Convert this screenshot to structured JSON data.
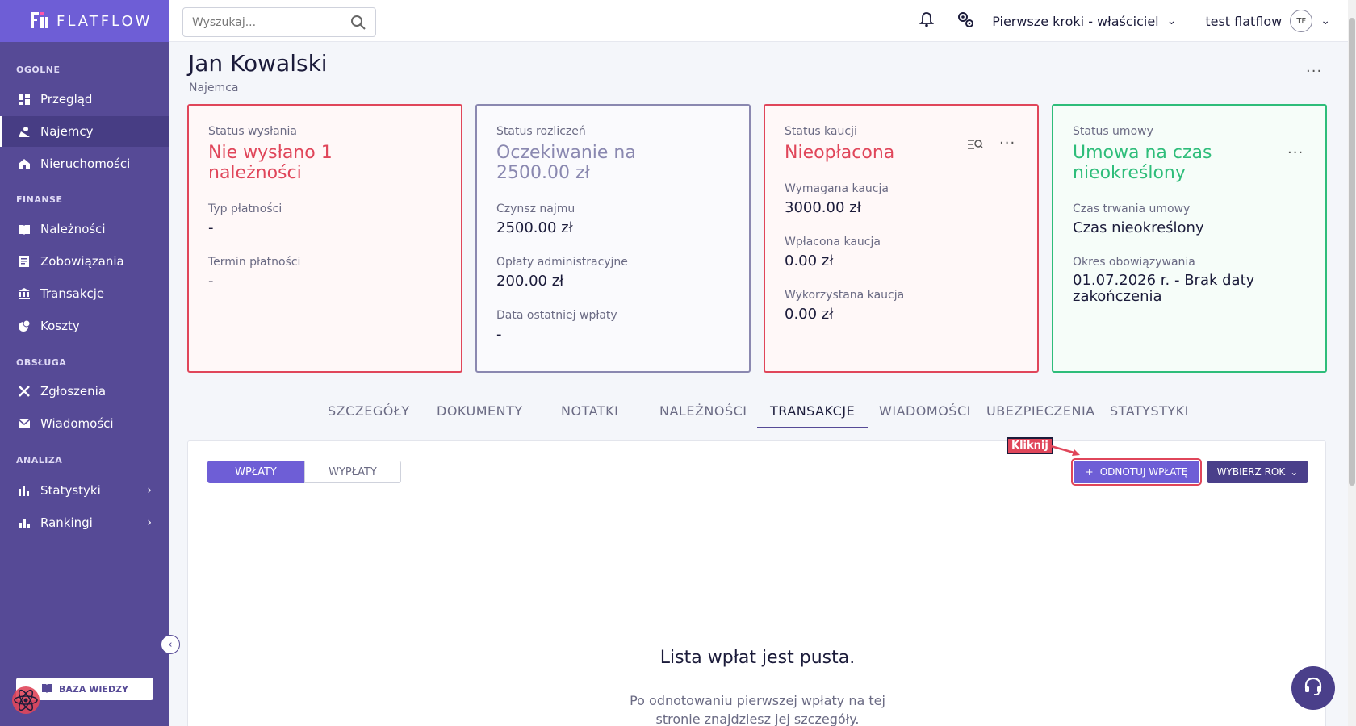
{
  "app": {
    "logo_text": "FLATFLOW"
  },
  "sidebar": {
    "sections": [
      {
        "label": "OGÓLNE"
      },
      {
        "label": "FINANSE"
      },
      {
        "label": "OBSŁUGA"
      },
      {
        "label": "ANALIZA"
      }
    ],
    "items": [
      {
        "label": "Przegląd",
        "icon": "dashboard-icon"
      },
      {
        "label": "Najemcy",
        "icon": "tenants-icon",
        "active": true
      },
      {
        "label": "Nieruchomości",
        "icon": "properties-icon"
      },
      {
        "label": "Należności",
        "icon": "receivables-icon"
      },
      {
        "label": "Zobowiązania",
        "icon": "liabilities-icon"
      },
      {
        "label": "Transakcje",
        "icon": "bank-icon"
      },
      {
        "label": "Koszty",
        "icon": "costs-icon"
      },
      {
        "label": "Zgłoszenia",
        "icon": "tools-icon"
      },
      {
        "label": "Wiadomości",
        "icon": "mail-icon"
      },
      {
        "label": "Statystyki",
        "icon": "stats-icon"
      },
      {
        "label": "Rankingi",
        "icon": "ranking-icon"
      }
    ],
    "knowledge_base_label": "BAZA WIEDZY"
  },
  "topbar": {
    "search_placeholder": "Wyszukaj...",
    "onboarding_label": "Pierwsze kroki - właściciel",
    "user_name": "test flatflow",
    "user_initials": "TF"
  },
  "page": {
    "title": "Jan Kowalski",
    "subtitle": "Najemca"
  },
  "cards": {
    "sending": {
      "label": "Status wysłania",
      "status": "Nie wysłano 1 należności",
      "payment_type_label": "Typ płatności",
      "payment_type_value": "-",
      "due_label": "Termin płatności",
      "due_value": "-"
    },
    "settlement": {
      "label": "Status rozliczeń",
      "status": "Oczekiwanie na 2500.00 zł",
      "rent_label": "Czynsz najmu",
      "rent_value": "2500.00 zł",
      "admin_label": "Opłaty administracyjne",
      "admin_value": "200.00 zł",
      "last_payment_label": "Data ostatniej wpłaty",
      "last_payment_value": "-"
    },
    "deposit": {
      "label": "Status kaucji",
      "status": "Nieopłacona",
      "required_label": "Wymagana kaucja",
      "required_value": "3000.00 zł",
      "paid_label": "Wpłacona kaucja",
      "paid_value": "0.00 zł",
      "used_label": "Wykorzystana kaucja",
      "used_value": "0.00 zł"
    },
    "contract": {
      "label": "Status umowy",
      "status": "Umowa na czas nieokreślony",
      "duration_label": "Czas trwania umowy",
      "duration_value": "Czas nieokreślony",
      "period_label": "Okres obowiązywania",
      "period_value": "01.07.2026 r. - Brak daty zakończenia"
    }
  },
  "tabs": [
    "SZCZEGÓŁY",
    "DOKUMENTY",
    "NOTATKI",
    "NALEŻNOŚCI",
    "TRANSAKCJE",
    "WIADOMOŚCI",
    "UBEZPIECZENIA",
    "STATYSTYKI"
  ],
  "transactions": {
    "toggle_in": "WPŁATY",
    "toggle_out": "WYPŁATY",
    "add_button": "ODNOTUJ WPŁATĘ",
    "year_button": "WYBIERZ ROK",
    "empty_title": "Lista wpłat jest pusta.",
    "empty_sub_1": "Po odnotowaniu pierwszej wpłaty na tej",
    "empty_sub_2": "stronie znajdziesz jej szczegóły."
  },
  "annotation": {
    "label": "Kliknij"
  },
  "colors": {
    "accent": "#6e5ed6",
    "sidebar": "#564a96",
    "error": "#e0465a",
    "success": "#2ebd7a",
    "neutral": "#8a88b0"
  }
}
